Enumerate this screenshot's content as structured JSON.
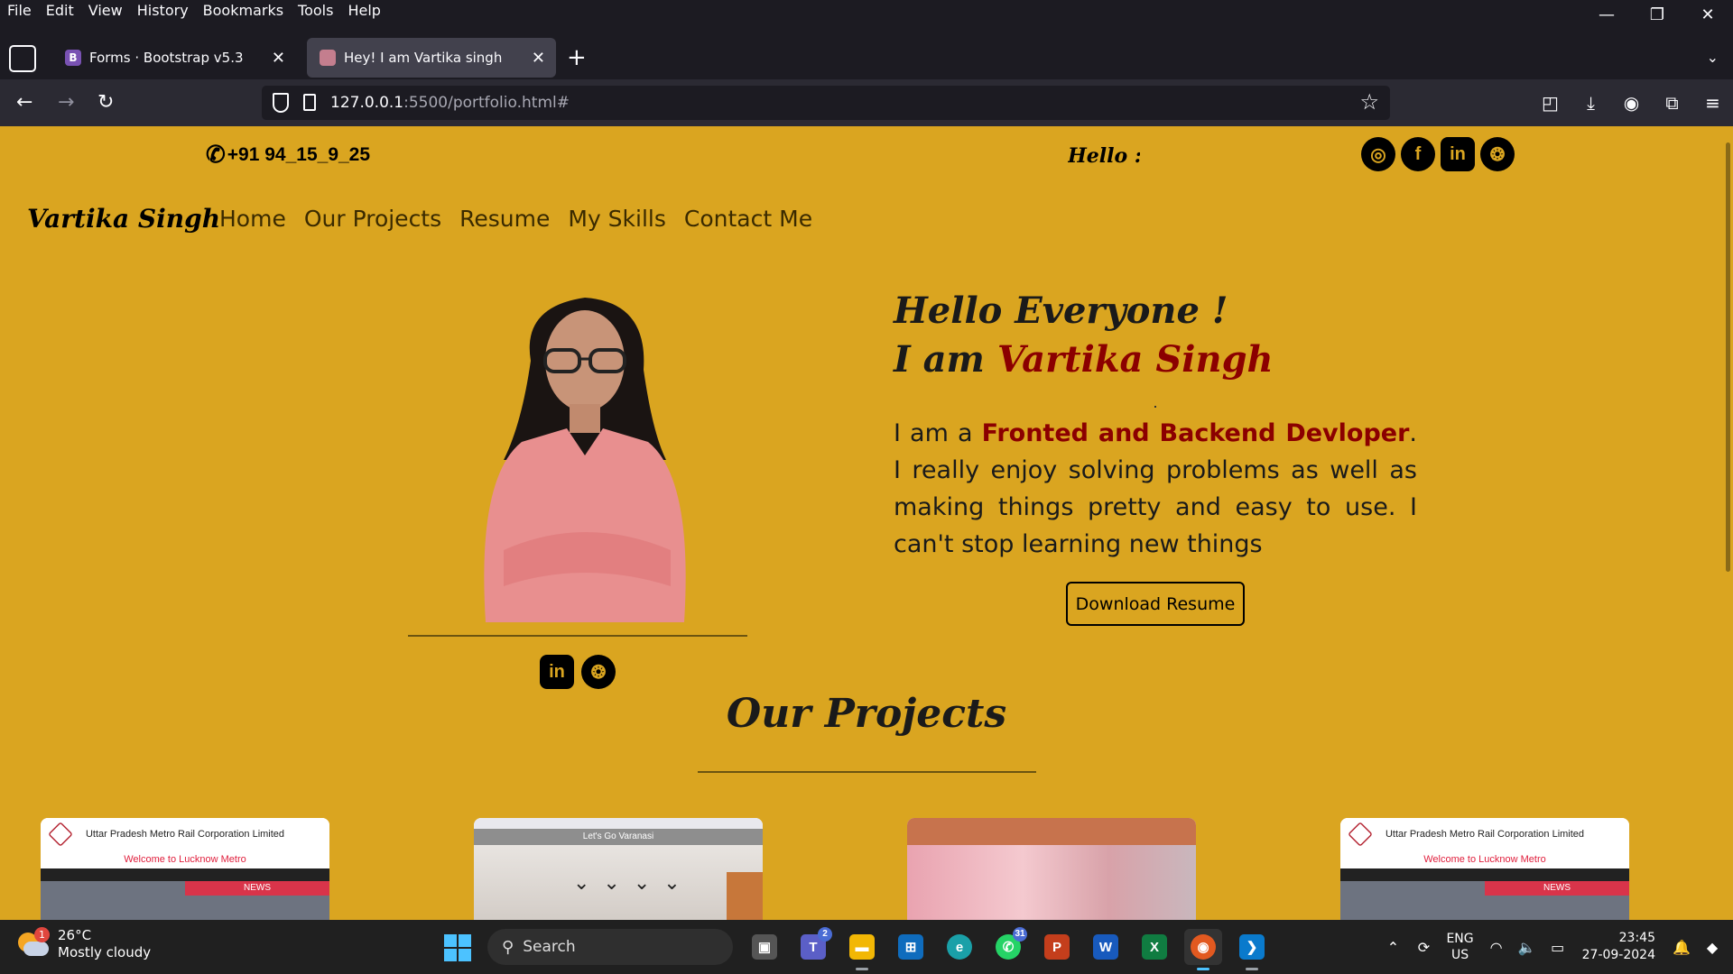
{
  "menubar": {
    "items": [
      "File",
      "Edit",
      "View",
      "History",
      "Bookmarks",
      "Tools",
      "Help"
    ]
  },
  "window_controls": {
    "minimize": "—",
    "restore": "❐",
    "close": "✕"
  },
  "tabs": [
    {
      "title": "Forms · Bootstrap v5.3",
      "favicon": "B",
      "favicon_color": "#7952b3"
    },
    {
      "title": "Hey! I am Vartika singh",
      "favicon": "",
      "favicon_color": "#c47e8e"
    }
  ],
  "urlbar": {
    "host": "127.0.0.1",
    "rest": ":5500/portfolio.html#"
  },
  "page": {
    "bg_color": "#daa520",
    "accent_color": "#8b0000",
    "phone": "+91 94_15_9_25",
    "marquee_text": "Hello :",
    "top_socials": [
      "instagram-icon",
      "facebook-icon",
      "linkedin-icon",
      "github-icon"
    ],
    "brand": "Vartika Singh",
    "nav": [
      "Home",
      "Our Projects",
      "Resume",
      "My Skills",
      "Contact Me"
    ],
    "hello_line1": "Hello Everyone !",
    "hello_line2_prefix": "I am ",
    "hello_name": "Vartika Singh",
    "bio_prefix": "I am a ",
    "bio_highlight": "Fronted and Backend Devloper",
    "bio_rest": ". I really enjoy solving problems as well as making things pretty and easy to use. I can't stop learning new things",
    "download_btn": "Download Resume",
    "mid_socials": [
      "linkedin-icon",
      "github-icon"
    ],
    "projects_title": "Our Projects",
    "projects": [
      {
        "kind": "metro",
        "header": "Uttar Pradesh Metro Rail Corporation Limited",
        "welcome": "Welcome to Lucknow Metro",
        "news": "NEWS"
      },
      {
        "kind": "varanasi",
        "banner": "Let's Go Varanasi"
      },
      {
        "kind": "cake"
      },
      {
        "kind": "metro",
        "header": "Uttar Pradesh Metro Rail Corporation Limited",
        "welcome": "Welcome to Lucknow Metro",
        "news": "NEWS"
      }
    ]
  },
  "taskbar": {
    "temp": "26°C",
    "weather": "Mostly cloudy",
    "weather_badge": "1",
    "search": "Search",
    "teams_badge": "2",
    "whatsapp_badge": "31",
    "lang_line1": "ENG",
    "lang_line2": "US",
    "time": "23:45",
    "date": "27-09-2024"
  }
}
